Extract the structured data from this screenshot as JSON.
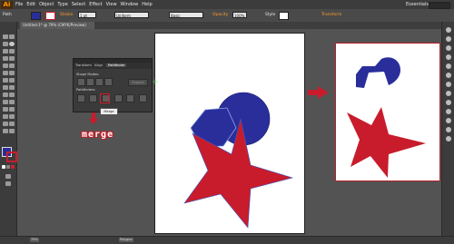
{
  "app": {
    "logo": "Ai",
    "menu": [
      "File",
      "Edit",
      "Object",
      "Type",
      "Select",
      "Effect",
      "View",
      "Window",
      "Help"
    ],
    "workspace": "Essentials"
  },
  "control_bar": {
    "selection_label": "Path",
    "stroke_label": "Stroke",
    "stroke_width": "1 pt",
    "profile": "Uniform",
    "brush": "Basic",
    "opacity_label": "Opacity",
    "opacity_value": "100%",
    "style_label": "Style",
    "transform_label": "Transform"
  },
  "document_tab": {
    "title": "Untitled-1* @ 79% (CMYK/Preview)"
  },
  "pathfinder_panel": {
    "tabs": [
      "Transform",
      "Align",
      "Pathfinder"
    ],
    "active_tab": "Pathfinder",
    "shape_modes_label": "Shape Modes:",
    "pathfinders_label": "Pathfinders:",
    "expand_label": "Expand",
    "tooltip": "Merge"
  },
  "annotation": {
    "merge_word": "merge"
  },
  "status_bar": {
    "zoom": "79%",
    "tool": "Polygon"
  },
  "colors": {
    "blue_shape": "#2a2e9b",
    "red_shape": "#c81c2c",
    "highlight": "#d21f2b"
  },
  "icons": {
    "arrow_to_result": "right-arrow-icon",
    "arrow_down": "down-arrow-icon"
  }
}
